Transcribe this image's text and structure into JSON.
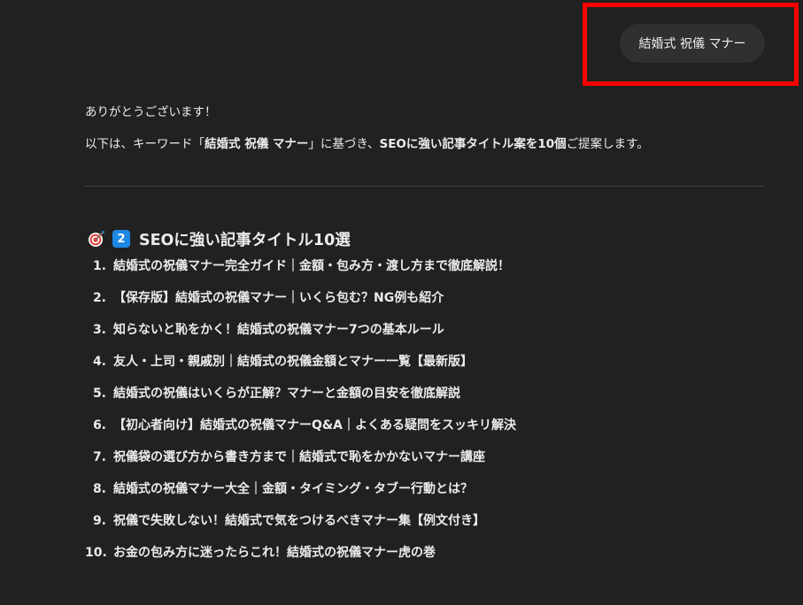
{
  "user_message": {
    "text": "結婚式 祝儀 マナー"
  },
  "assistant_message": {
    "greeting": "ありがとうございます！",
    "intro_prefix": "以下は、キーワード「",
    "intro_keyword": "結婚式 祝儀 マナー",
    "intro_middle": "」に基づき、",
    "intro_bold": "SEOに強い記事タイトル案を10個",
    "intro_suffix": "ご提案します。",
    "section": {
      "target_icon": "direct-hit-icon",
      "number_badge": "2",
      "heading": "SEOに強い記事タイトル10選"
    },
    "titles": [
      {
        "num": "1.",
        "text": "結婚式の祝儀マナー完全ガイド｜金額・包み方・渡し方まで徹底解説！"
      },
      {
        "num": "2.",
        "text": "【保存版】結婚式の祝儀マナー｜いくら包む？NG例も紹介"
      },
      {
        "num": "3.",
        "text": "知らないと恥をかく！結婚式の祝儀マナー7つの基本ルール"
      },
      {
        "num": "4.",
        "text": "友人・上司・親戚別｜結婚式の祝儀金額とマナー一覧【最新版】"
      },
      {
        "num": "5.",
        "text": "結婚式の祝儀はいくらが正解？マナーと金額の目安を徹底解説"
      },
      {
        "num": "6.",
        "text": "【初心者向け】結婚式の祝儀マナーQ&A｜よくある疑問をスッキリ解決"
      },
      {
        "num": "7.",
        "text": "祝儀袋の選び方から書き方まで｜結婚式で恥をかかないマナー講座"
      },
      {
        "num": "8.",
        "text": "結婚式の祝儀マナー大全｜金額・タイミング・タブー行動とは？"
      },
      {
        "num": "9.",
        "text": "祝儀で失敗しない！結婚式で気をつけるべきマナー集【例文付き】"
      },
      {
        "num": "10.",
        "text": "お金の包み方に迷ったらこれ！結婚式の祝儀マナー虎の巻"
      }
    ]
  },
  "colors": {
    "background": "#212121",
    "user_bubble": "#303030",
    "highlight": "#ff0000",
    "text": "#ececec",
    "badge": "#1e88e5"
  }
}
